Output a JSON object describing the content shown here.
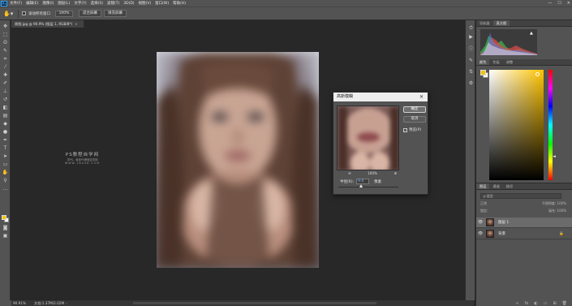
{
  "app": {
    "logo": "Ps",
    "menu": [
      "文件(F)",
      "编辑(E)",
      "图像(I)",
      "图层(L)",
      "文字(Y)",
      "选择(S)",
      "滤镜(T)",
      "3D(D)",
      "视图(V)",
      "窗口(W)",
      "帮助(H)"
    ],
    "window_controls": [
      "—",
      "☐",
      "✕"
    ]
  },
  "options_bar": {
    "tool_icon": "hand-icon",
    "checkbox_label": "滚动所有窗口",
    "zoom_value": "100%",
    "fit_screen": "适合屏幕",
    "fill_screen": "填充屏幕"
  },
  "document": {
    "tab_title": "原图.jpg @ 90.9% (图层 1, RGB/8*)",
    "tab_close": "×",
    "status_zoom": "90.91%",
    "status_doc": "文档:1.37M/2.02M",
    "status_arrow": "›"
  },
  "watermark": {
    "line1": "PS教程自学网",
    "line2": "学PS，就到PS教程自学网",
    "line3": "WWW.16XX8.COM"
  },
  "dialog": {
    "title": "高斯模糊",
    "close": "✕",
    "ok": "确定",
    "cancel": "取消",
    "preview_label": "预览(P)",
    "preview_checked": true,
    "zoom_out": "⊖",
    "zoom_level": "100%",
    "zoom_in": "⊕",
    "radius_label": "半径(R):",
    "radius_value": "9.0",
    "radius_unit": "像素",
    "slider_position": 0.38
  },
  "histogram_panel": {
    "tabs": [
      "导航器",
      "直方图"
    ],
    "active_tab": 1,
    "warning_icon": "▲"
  },
  "color_panel": {
    "tabs": [
      "颜色",
      "色板",
      "调整"
    ],
    "active_tab": 0,
    "foreground": "#f5c300",
    "background": "#ffffff",
    "hue_arrow": "◄"
  },
  "layers_panel": {
    "tabs": [
      "图层",
      "通道",
      "路径"
    ],
    "active_tab": 0,
    "filter_placeholder": "ρ 类型",
    "blend_mode": "正常",
    "opacity_label": "不透明度: 100%",
    "lock_label": "锁定:",
    "fill_label": "填充: 100%",
    "layers": [
      {
        "name": "图层 1",
        "selected": true,
        "visible": true,
        "locked": false
      },
      {
        "name": "背景",
        "selected": false,
        "visible": true,
        "locked": true
      }
    ],
    "bottom_icons": [
      "∞",
      "fx",
      "◐",
      "▭",
      "⊞",
      "🗑"
    ]
  }
}
